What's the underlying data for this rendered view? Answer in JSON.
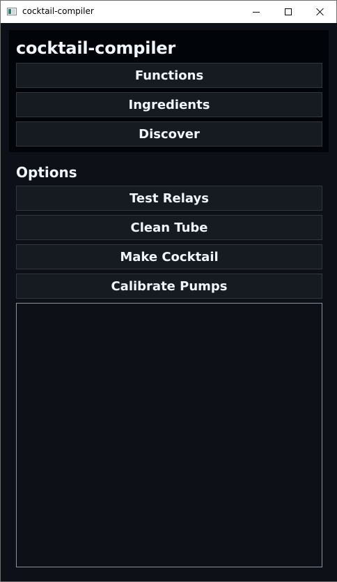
{
  "window": {
    "title": "cocktail-compiler",
    "controls": [
      "minimize-icon",
      "maximize-icon",
      "close-icon"
    ]
  },
  "header": {
    "title": "cocktail-compiler",
    "nav": [
      {
        "label": "Functions"
      },
      {
        "label": "Ingredients"
      },
      {
        "label": "Discover"
      }
    ]
  },
  "options": {
    "title": "Options",
    "buttons": [
      {
        "label": "Test Relays"
      },
      {
        "label": "Clean Tube"
      },
      {
        "label": "Make Cocktail"
      },
      {
        "label": "Calibrate Pumps"
      }
    ]
  },
  "output": {
    "text": ""
  },
  "colors": {
    "background": "#0d1117",
    "panel": "#010409",
    "button": "#161b22",
    "button_border": "#30363d",
    "text": "#f0f6fc"
  }
}
